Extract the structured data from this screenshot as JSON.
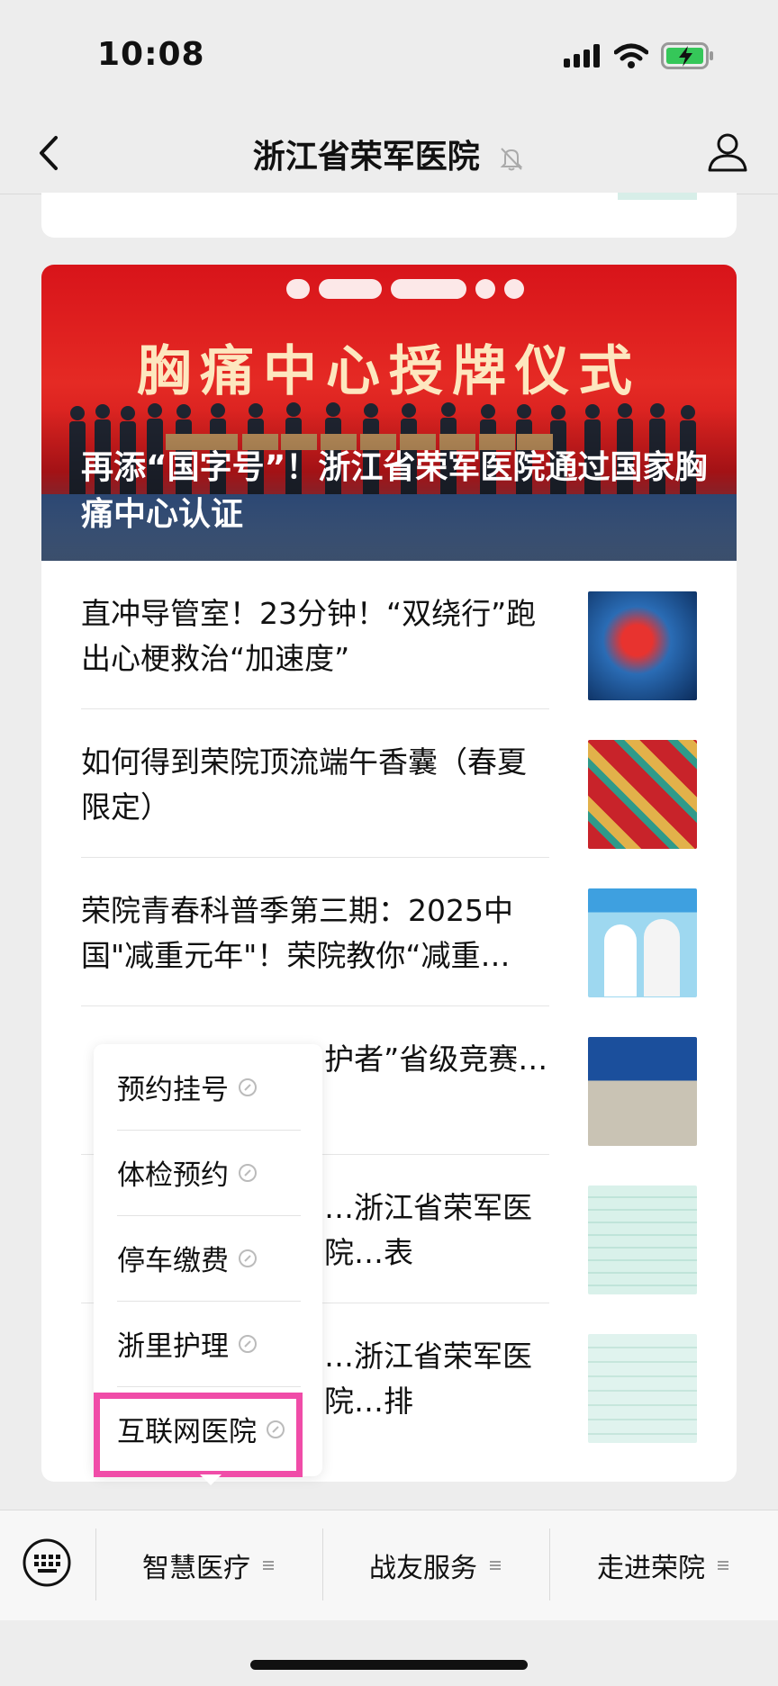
{
  "status_bar": {
    "time": "10:08"
  },
  "nav": {
    "title": "浙江省荣军医院"
  },
  "hero": {
    "banner_text": "胸痛中心授牌仪式",
    "title": "再添“国字号”！浙江省荣军医院通过国家胸痛中心认证"
  },
  "articles": [
    {
      "title": "直冲导管室！23分钟！“双绕行”跑出心梗救治“加速度”",
      "thumb": "heart-image"
    },
    {
      "title": "如何得到荣院顶流端午香囊（春夏限定）",
      "thumb": "sachet-image"
    },
    {
      "title": "荣院青春科普季第三期：2025中国\"减重元年\"！荣院教你“减重…",
      "thumb": "weight-loss-image"
    },
    {
      "title": "“…护者”省级竞赛…",
      "thumb": "award-image"
    },
    {
      "title": "…浙江省荣军医院…表",
      "thumb": "schedule-image"
    },
    {
      "title": "…浙江省荣军医院…排",
      "thumb": "schedule-image-2"
    }
  ],
  "popup_menu": {
    "items": [
      "预约挂号",
      "体检预约",
      "停车缴费",
      "浙里护理",
      "互联网医院"
    ],
    "highlight_color": "#f04ca8"
  },
  "bottom_menu": {
    "items": [
      "智慧医疗",
      "战友服务",
      "走进荣院"
    ]
  },
  "colors": {
    "hero_red": "#d8141a",
    "accent_pink": "#f04ca8",
    "battery_green": "#35c759"
  }
}
